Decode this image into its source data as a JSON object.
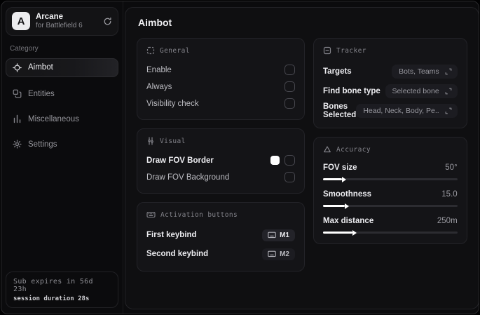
{
  "app": {
    "logo_letter": "A",
    "name": "Arcane",
    "subtitle": "for Battlefield 6"
  },
  "sidebar": {
    "category_label": "Category",
    "items": [
      {
        "label": "Aimbot",
        "icon": "crosshair-icon",
        "active": true
      },
      {
        "label": "Entities",
        "icon": "entities-icon",
        "active": false
      },
      {
        "label": "Miscellaneous",
        "icon": "columns-icon",
        "active": false
      },
      {
        "label": "Settings",
        "icon": "gear-icon",
        "active": false
      }
    ],
    "subscription": {
      "expires_text": "Sub expires in 56d 23h",
      "session_text": "session duration 28s"
    }
  },
  "main": {
    "title": "Aimbot",
    "general": {
      "title": "General",
      "rows": [
        {
          "label": "Enable",
          "checked": false
        },
        {
          "label": "Always",
          "checked": false
        },
        {
          "label": "Visibility check",
          "checked": false
        }
      ]
    },
    "visual": {
      "title": "Visual",
      "rows": [
        {
          "label": "Draw FOV Border",
          "swatch_color": "#ffffff",
          "checked": false
        },
        {
          "label": "Draw FOV Background",
          "checked": false
        }
      ]
    },
    "activation": {
      "title": "Activation buttons",
      "rows": [
        {
          "label": "First keybind",
          "key": "M1"
        },
        {
          "label": "Second keybind",
          "key": "M2"
        }
      ]
    },
    "tracker": {
      "title": "Tracker",
      "rows": [
        {
          "label": "Targets",
          "value": "Bots, Teams"
        },
        {
          "label": "Find bone type",
          "value": "Selected bone"
        },
        {
          "label": "Bones Selected",
          "value": "Head, Neck, Body, Pe.."
        }
      ]
    },
    "accuracy": {
      "title": "Accuracy",
      "sliders": [
        {
          "label": "FOV size",
          "value": "50°",
          "percent": 14
        },
        {
          "label": "Smoothness",
          "value": "15.0",
          "percent": 16
        },
        {
          "label": "Max distance",
          "value": "250m",
          "percent": 22
        }
      ]
    }
  },
  "colors": {
    "fov_border_swatch": "#ffffff",
    "panel_background": "#0f0f11",
    "card_background": "#141417"
  }
}
